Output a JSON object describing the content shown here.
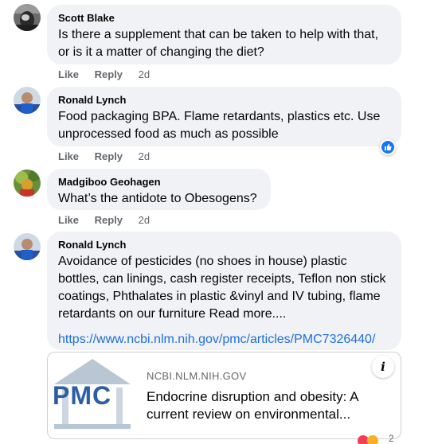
{
  "comments": [
    {
      "author": "Scott Blake",
      "lines": [
        "Is there a supplement that can be taken to help with that,",
        "or is it a matter of changing the diet?"
      ],
      "like": "Like",
      "reply": "Reply",
      "time": "2d"
    },
    {
      "author": "Ronald Lynch",
      "lines": [
        "Food packaging BPA. Flame retardants, plastics etc. Use",
        "unprocessed food as much as possible"
      ],
      "like": "Like",
      "reply": "Reply",
      "time": "2d"
    },
    {
      "author": "Madgiboo Geohagen",
      "lines": [
        "What’s the antidote to Obesogens?"
      ],
      "like": "Like",
      "reply": "Reply",
      "time": "2d"
    },
    {
      "author": "Ronald Lynch",
      "lines": [
        "Avoidance of pesticides (no shoes in house) plastic",
        "bottles, can linings, cash register receipts, Teflon non stick",
        "coatings, Phthalates in plastic &vinyl and IV tubing, flame",
        "retardants on our furniture Read more...."
      ],
      "link": "https://www.ncbi.nlm.nih.gov/pmc/articles/PMC7326440/"
    }
  ],
  "preview": {
    "logo_text": "PMC",
    "domain": "NCBI.NLM.NIH.GOV",
    "title_line1": "Endocrine disruption and obesity: A",
    "title_line2": "current review on environmental...",
    "info_label": "i"
  },
  "reaction_count": "2",
  "colors": {
    "bubble": "#f0f2f5",
    "link": "#216fdb",
    "like_blue": "#1877f2",
    "meta_gray": "#65676b"
  }
}
